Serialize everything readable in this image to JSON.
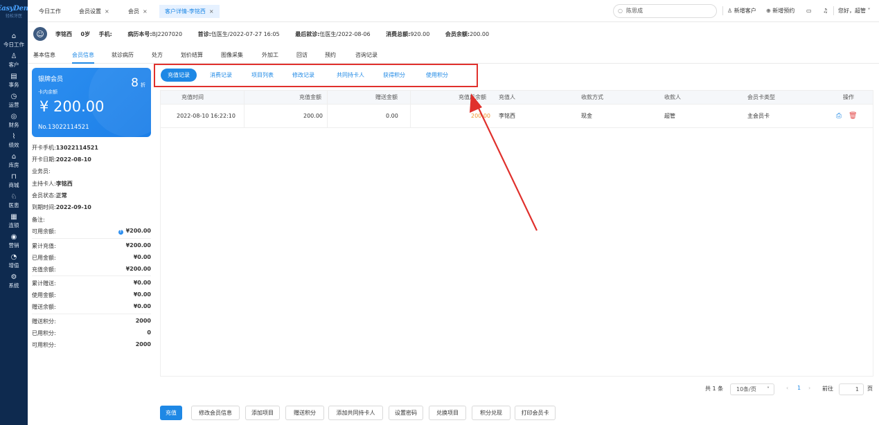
{
  "brand": {
    "name": "EasyDent",
    "sub": "轻松牙医"
  },
  "nav": [
    {
      "icon": "⌂",
      "label": "今日工作"
    },
    {
      "icon": "♙",
      "label": "客户"
    },
    {
      "icon": "▤",
      "label": "事务"
    },
    {
      "icon": "◷",
      "label": "运营"
    },
    {
      "icon": "◎",
      "label": "财务"
    },
    {
      "icon": "⌇",
      "label": "绩效"
    },
    {
      "icon": "⌂",
      "label": "库房"
    },
    {
      "icon": "⊓",
      "label": "商城"
    },
    {
      "icon": "♘",
      "label": "医患"
    },
    {
      "icon": "▦",
      "label": "连锁"
    },
    {
      "icon": "◉",
      "label": "营销"
    },
    {
      "icon": "◔",
      "label": "增值"
    },
    {
      "icon": "⚙",
      "label": "系统"
    }
  ],
  "tabs": [
    {
      "label": "今日工作",
      "close": ""
    },
    {
      "label": "会员设置",
      "close": "×"
    },
    {
      "label": "会员",
      "close": "×"
    },
    {
      "label": "客户详情-李铭西",
      "close": "×"
    }
  ],
  "topright": {
    "search_value": "陈思成",
    "new_customer": "新增客户",
    "new_appointment": "新增预约",
    "greeting": "您好，超管"
  },
  "patient": {
    "name": "李铭西",
    "age": "0岁",
    "phone_label": "手机:",
    "phone": "",
    "record_label": "病历本号:",
    "record": "BJ2207020",
    "first_label": "首诊:",
    "first": "伍医生/2022-07-27 16:05",
    "last_label": "最后就诊:",
    "last": "伍医生/2022-08-06",
    "total_label": "消费总额:",
    "total": "920.00",
    "balance_label": "会员余额:",
    "balance": "200.00"
  },
  "subtabs": [
    "基本信息",
    "会员信息",
    "就诊病历",
    "处方",
    "划价结算",
    "图像采集",
    "外加工",
    "回访",
    "预约",
    "咨询记录"
  ],
  "card": {
    "title": "银牌会员",
    "discount": "8",
    "discount_unit": "折",
    "balance_label": "卡内余额",
    "balance": "¥ 200.00",
    "card_no": "No.13022114521"
  },
  "member_info": [
    {
      "label": "开卡手机:",
      "value": "13022114521"
    },
    {
      "label": "开卡日期:",
      "value": "2022-08-10"
    },
    {
      "label": "业务员:",
      "value": ""
    },
    {
      "label": "主持卡人:",
      "value": "李铭西"
    },
    {
      "label": "会员状态:",
      "value": "正常"
    },
    {
      "label": "到期时间:",
      "value": "2022-09-10"
    },
    {
      "label": "备注:",
      "value": ""
    }
  ],
  "amounts": [
    {
      "label": "可用余额:",
      "value": "¥200.00"
    },
    {
      "label": "累计充值:",
      "value": "¥200.00"
    },
    {
      "label": "已用金额:",
      "value": "¥0.00"
    },
    {
      "label": "充值余额:",
      "value": "¥200.00"
    },
    {
      "label": "累计赠送:",
      "value": "¥0.00"
    },
    {
      "label": "使用金额:",
      "value": "¥0.00"
    },
    {
      "label": "赠送余额:",
      "value": "¥0.00"
    },
    {
      "label": "赠送积分:",
      "value": "2000"
    },
    {
      "label": "已用积分:",
      "value": "0"
    },
    {
      "label": "可用积分:",
      "value": "2000"
    }
  ],
  "record_tabs": [
    "充值记录",
    "消费记录",
    "项目列表",
    "修改记录",
    "共同持卡人",
    "获得积分",
    "使用积分"
  ],
  "table": {
    "headers": [
      "充值时间",
      "充值金额",
      "赠送金额",
      "充值后余额",
      "充值人",
      "收款方式",
      "收款人",
      "会员卡类型",
      "操作"
    ],
    "rows": [
      [
        "2022-08-10 16:22:10",
        "200.00",
        "0.00",
        "200.00",
        "李铭西",
        "现金",
        "超管",
        "主会员卡"
      ]
    ]
  },
  "pager": {
    "total": "共 1 条",
    "size": "10条/页",
    "page": "1",
    "goto": "前往",
    "goto_value": "1",
    "page_unit": "页"
  },
  "actions": [
    "充值",
    "修改会员信息",
    "添加项目",
    "赠送积分",
    "添加共同持卡人",
    "设置密码",
    "兑换项目",
    "积分兑现",
    "打印会员卡"
  ],
  "colors": {
    "accent": "#1e88e5",
    "nav_bg": "#0e2a4f",
    "annotation": "#e0302c",
    "balance_highlight": "#f0932b",
    "delete": "#e34b4b"
  }
}
